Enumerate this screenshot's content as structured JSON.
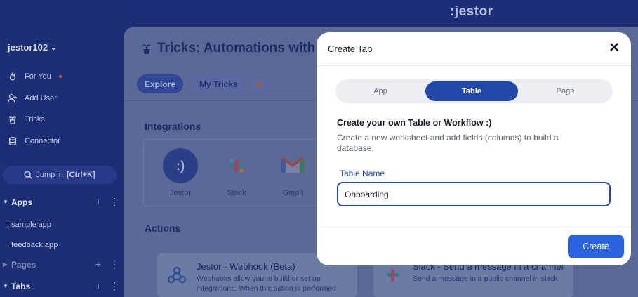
{
  "brand": ":jestor",
  "sidebar": {
    "workspace": "jestor102",
    "items": [
      {
        "label": "For You",
        "icon": "flame-icon"
      },
      {
        "label": "Add User",
        "icon": "add-user-icon"
      },
      {
        "label": "Tricks",
        "icon": "plant-icon"
      },
      {
        "label": "Connector",
        "icon": "database-icon"
      }
    ],
    "jump": {
      "label": "Jump in",
      "shortcut": "[Ctrl+K]"
    },
    "sections": {
      "apps": "Apps",
      "pages": "Pages",
      "tabs": "Tabs"
    },
    "apps": [
      ":: sample app",
      ":: feedback app"
    ]
  },
  "main": {
    "title": "Tricks: Automations with",
    "tabs": [
      "Explore",
      "My Tricks"
    ],
    "integrations_title": "Integrations",
    "integrations": [
      "Jestor",
      "Slack",
      "Gmail"
    ],
    "actions_title": "Actions",
    "actions": [
      {
        "title": "Jestor - Webhook (Beta)",
        "desc": "Webhooks allow you to build or set up integrations. When this action is performed"
      },
      {
        "title": "Slack - Send a message in a channel",
        "desc": "Send a message in a public channel in slack"
      }
    ]
  },
  "modal": {
    "title": "Create Tab",
    "segments": [
      "App",
      "Table",
      "Page"
    ],
    "selected_segment": "Table",
    "heading": "Create your own Table or Workflow :)",
    "description": "Create a new worksheet and add fields (columns) to build a database.",
    "field_label": "Table Name",
    "field_value": "Onboarding",
    "create_label": "Create"
  },
  "colors": {
    "accent": "#2348ac",
    "create_button": "#2b63e0",
    "sidebar_bg": "#1d2f74"
  }
}
